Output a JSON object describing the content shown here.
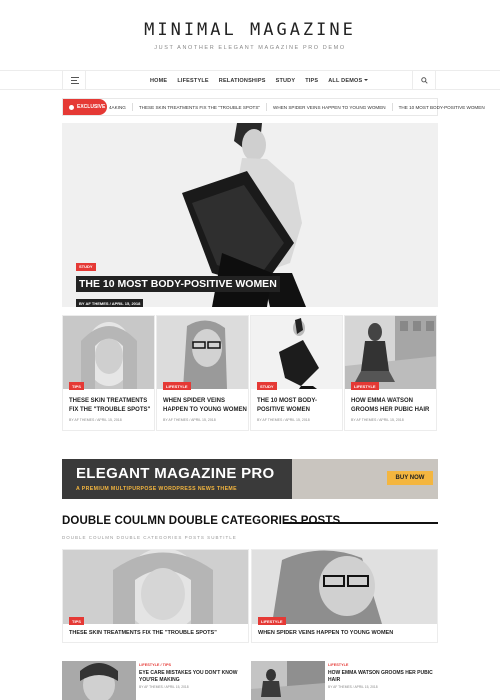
{
  "header": {
    "site_title": "MINIMAL MAGAZINE",
    "tagline": "JUST ANOTHER ELEGANT MAGAZINE PRO DEMO"
  },
  "nav": {
    "items": [
      "HOME",
      "LIFESTYLE",
      "RELATIONSHIPS",
      "STUDY",
      "TIPS",
      "ALL DEMOS"
    ]
  },
  "ticker": {
    "label": "EXCLUSIVE",
    "items": [
      "4AKING",
      "THESE SKIN TREATMENTS FIX THE \"TROUBLE SPOTS\"",
      "WHEN SPIDER VEINS HAPPEN TO YOUNG WOMEN",
      "THE 10 MOST BODY-POSITIVE WOMEN"
    ]
  },
  "hero": {
    "category": "STUDY",
    "title": "THE 10 MOST BODY-POSITIVE WOMEN",
    "meta": "BY AF THEMES / APRIL 15, 2018"
  },
  "grid": [
    {
      "category": "TIPS",
      "title": "THESE SKIN TREATMENTS FIX THE \"TROUBLE SPOTS\"",
      "meta": "BY AF THEMES / APRIL 15, 2018"
    },
    {
      "category": "LIFESTYLE",
      "title": "WHEN SPIDER VEINS HAPPEN TO YOUNG WOMEN",
      "meta": "BY AF THEMES / APRIL 15, 2018"
    },
    {
      "category": "STUDY",
      "title": "THE 10 MOST BODY-POSITIVE WOMEN",
      "meta": "BY AF THEMES / APRIL 15, 2018"
    },
    {
      "category": "LIFESTYLE",
      "title": "HOW EMMA WATSON GROOMS HER PUBIC HAIR",
      "meta": "BY AF THEMES / APRIL 15, 2018"
    }
  ],
  "ad": {
    "title": "ELEGANT MAGAZINE PRO",
    "subtitle": "A PREMIUM MULTIPURPOSE WORDPRESS NEWS THEME",
    "button": "BUY NOW",
    "accent": "#f4b63f"
  },
  "section": {
    "title": "DOUBLE COULMN DOUBLE CATEGORIES POSTS",
    "subtitle": "DOUBLE COULMN DOUBLE CATEGORIES POSTS SUBTITLE"
  },
  "double": {
    "big": [
      {
        "category": "TIPS",
        "title": "THESE SKIN TREATMENTS FIX THE \"TROUBLE SPOTS\""
      },
      {
        "category": "LIFESTYLE",
        "title": "WHEN SPIDER VEINS HAPPEN TO YOUNG WOMEN"
      }
    ],
    "small": [
      {
        "category": "LIFESTYLE / TIPS",
        "title": "EYE CARE MISTAKES YOU DON'T KNOW YOU'RE MAKING",
        "meta": "BY AF THEMES / APRIL 15, 2018"
      },
      {
        "category": "LIFESTYLE",
        "title": "HOW EMMA WATSON GROOMS HER PUBIC HAIR",
        "meta": "BY AF THEMES / APRIL 15, 2018"
      }
    ]
  },
  "colors": {
    "accent_red": "#e53935",
    "dark": "#222222"
  }
}
